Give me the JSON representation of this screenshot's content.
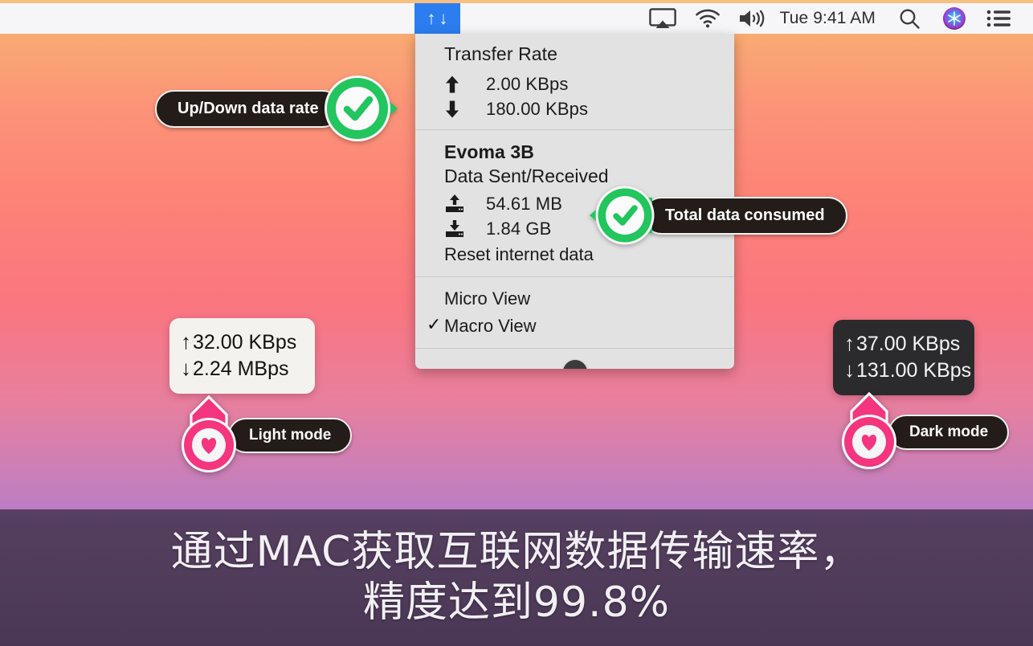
{
  "menubar": {
    "netspeed_up": "↑",
    "netspeed_down": "↓",
    "airplay_icon": "airplay-icon",
    "wifi_icon": "wifi-icon",
    "volume_icon": "volume-icon",
    "clock": "Tue 9:41 AM",
    "search_icon": "search-icon",
    "siri_icon": "siri-icon",
    "control_center_icon": "control-center-icon"
  },
  "dropdown": {
    "transfer_rate_title": "Transfer Rate",
    "rate_up_icon": "↑",
    "rate_up_value": "2.00 KBps",
    "rate_down_icon": "↓",
    "rate_down_value": "180.00 KBps",
    "device_name": "Evoma 3B",
    "data_section_title": "Data Sent/Received",
    "sent_value": "54.61 MB",
    "received_value": "1.84 GB",
    "reset_label": "Reset internet data",
    "micro_view_label": "Micro View",
    "macro_view_label": "Macro View",
    "macro_view_checked": "✓",
    "expand_icon": "chevron-down-icon"
  },
  "callouts": {
    "up_down_rate": "Up/Down data rate",
    "total_data": "Total data consumed",
    "light_mode": "Light mode",
    "dark_mode": "Dark mode"
  },
  "widgets": {
    "light": {
      "up_arrow": "↑",
      "up_value": "32.00 KBps",
      "down_arrow": "↓",
      "down_value": "2.24 MBps"
    },
    "dark": {
      "up_arrow": "↑",
      "up_value": "37.00 KBps",
      "down_arrow": "↓",
      "down_value": "131.00 KBps"
    }
  },
  "caption": {
    "line1": "通过MAC获取互联网数据传输速率，",
    "line2": "精度达到99.8%"
  },
  "colors": {
    "accent_blue": "#2b7df0",
    "badge_green": "#22c55e",
    "pin_pink": "#f6357f",
    "pill_dark": "#231c19",
    "caption_bg": "#483752"
  }
}
